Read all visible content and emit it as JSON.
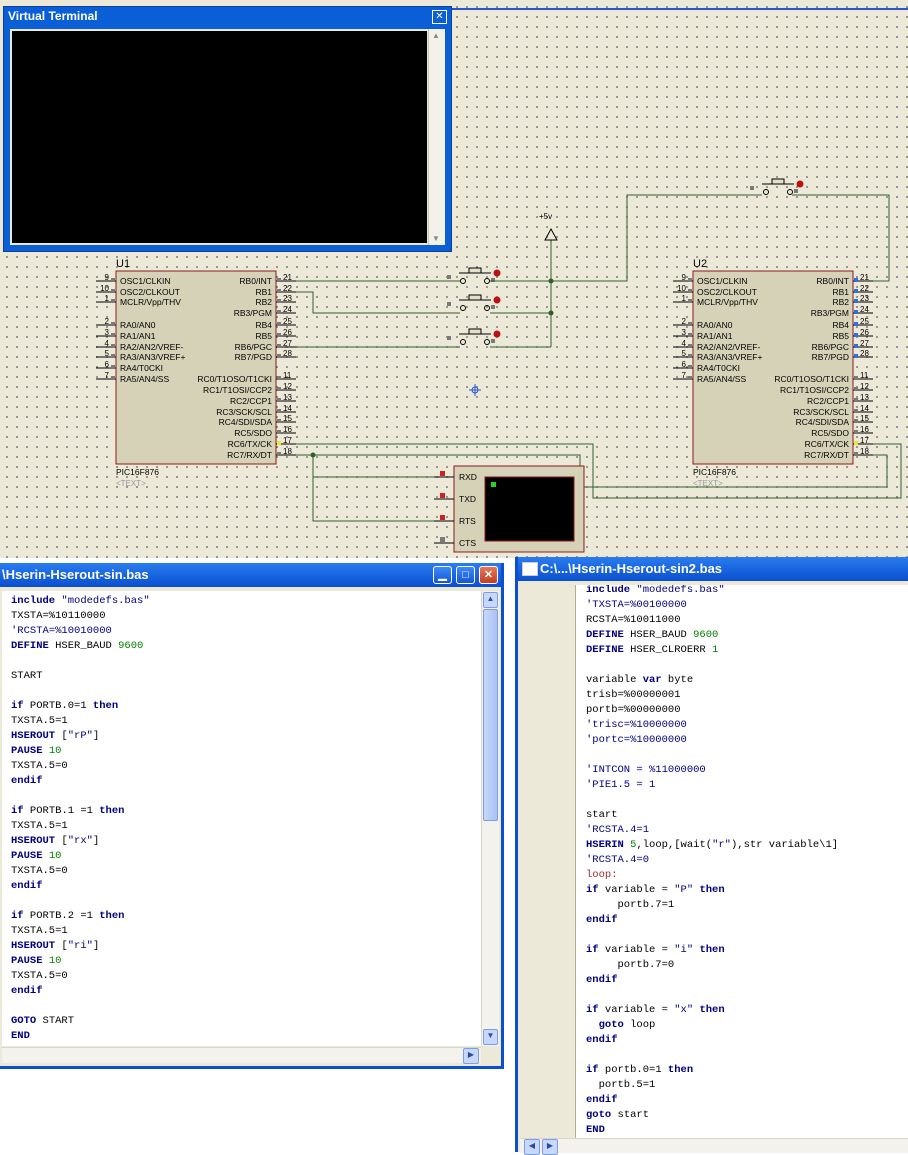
{
  "virtual_terminal": {
    "title": "Virtual Terminal",
    "close_glyph": "✕"
  },
  "schematic": {
    "power_label": "+5v",
    "u1": {
      "ref": "U1",
      "part": "PIC16F876",
      "text": "<TEXT>",
      "left_pins": [
        {
          "num": "9",
          "name": "OSC1/CLKIN"
        },
        {
          "num": "10",
          "name": "OSC2/CLKOUT"
        },
        {
          "num": "1",
          "name": "MCLR/Vpp/THV"
        },
        {
          "num": "2",
          "name": "RA0/AN0"
        },
        {
          "num": "3",
          "name": "RA1/AN1"
        },
        {
          "num": "4",
          "name": "RA2/AN2/VREF-"
        },
        {
          "num": "5",
          "name": "RA3/AN3/VREF+"
        },
        {
          "num": "6",
          "name": "RA4/T0CKI"
        },
        {
          "num": "7",
          "name": "RA5/AN4/SS"
        }
      ],
      "right_pins": [
        {
          "num": "21",
          "name": "RB0/INT"
        },
        {
          "num": "22",
          "name": "RB1"
        },
        {
          "num": "23",
          "name": "RB2"
        },
        {
          "num": "24",
          "name": "RB3/PGM"
        },
        {
          "num": "25",
          "name": "RB4"
        },
        {
          "num": "26",
          "name": "RB5"
        },
        {
          "num": "27",
          "name": "RB6/PGC"
        },
        {
          "num": "28",
          "name": "RB7/PGD"
        },
        {
          "num": "11",
          "name": "RC0/T1OSO/T1CKI"
        },
        {
          "num": "12",
          "name": "RC1/T1OSI/CCP2"
        },
        {
          "num": "13",
          "name": "RC2/CCP1"
        },
        {
          "num": "14",
          "name": "RC3/SCK/SCL"
        },
        {
          "num": "15",
          "name": "RC4/SDI/SDA"
        },
        {
          "num": "16",
          "name": "RC5/SDO"
        },
        {
          "num": "17",
          "name": "RC6/TX/CK"
        },
        {
          "num": "18",
          "name": "RC7/RX/DT"
        }
      ]
    },
    "u2": {
      "ref": "U2",
      "part": "PIC16F876",
      "text": "<TEXT>"
    },
    "terminal_pins": [
      "RXD",
      "TXD",
      "RTS",
      "CTS"
    ]
  },
  "editor1": {
    "title": "\\Hserin-Hserout-sin.bas",
    "lines": [
      [
        [
          "kw",
          "include"
        ],
        [
          "str",
          " \"modedefs.bas\""
        ]
      ],
      [
        [
          "",
          "TXSTA=%10110000"
        ]
      ],
      [
        [
          "cmt",
          "'RCSTA=%10010000"
        ]
      ],
      [
        [
          "kw",
          "DEFINE"
        ],
        [
          "",
          " HSER_BAUD "
        ],
        [
          "num",
          "9600"
        ]
      ],
      [],
      [
        [
          "",
          "START"
        ]
      ],
      [],
      [
        [
          "kw",
          "if"
        ],
        [
          "",
          " PORTB.0=1 "
        ],
        [
          "kw",
          "then"
        ]
      ],
      [
        [
          "",
          "TXSTA.5=1"
        ]
      ],
      [
        [
          "kw",
          "HSEROUT"
        ],
        [
          "",
          " ["
        ],
        [
          "str",
          "\"rP\""
        ],
        [
          "",
          "]"
        ]
      ],
      [
        [
          "kw",
          "PAUSE"
        ],
        [
          "",
          " "
        ],
        [
          "num",
          "10"
        ]
      ],
      [
        [
          "",
          "TXSTA.5=0"
        ]
      ],
      [
        [
          "kw",
          "endif"
        ]
      ],
      [],
      [
        [
          "kw",
          "if"
        ],
        [
          "",
          " PORTB.1 =1 "
        ],
        [
          "kw",
          "then"
        ]
      ],
      [
        [
          "",
          "TXSTA.5=1"
        ]
      ],
      [
        [
          "kw",
          "HSEROUT"
        ],
        [
          "",
          " ["
        ],
        [
          "str",
          "\"rx\""
        ],
        [
          "",
          "]"
        ]
      ],
      [
        [
          "kw",
          "PAUSE"
        ],
        [
          "",
          " "
        ],
        [
          "num",
          "10"
        ]
      ],
      [
        [
          "",
          "TXSTA.5=0"
        ]
      ],
      [
        [
          "kw",
          "endif"
        ]
      ],
      [],
      [
        [
          "kw",
          "if"
        ],
        [
          "",
          " PORTB.2 =1 "
        ],
        [
          "kw",
          "then"
        ]
      ],
      [
        [
          "",
          "TXSTA.5=1"
        ]
      ],
      [
        [
          "kw",
          "HSEROUT"
        ],
        [
          "",
          " ["
        ],
        [
          "str",
          "\"ri\""
        ],
        [
          "",
          "]"
        ]
      ],
      [
        [
          "kw",
          "PAUSE"
        ],
        [
          "",
          " "
        ],
        [
          "num",
          "10"
        ]
      ],
      [
        [
          "",
          "TXSTA.5=0"
        ]
      ],
      [
        [
          "kw",
          "endif"
        ]
      ],
      [],
      [
        [
          "kw",
          "GOTO"
        ],
        [
          "",
          " START"
        ]
      ],
      [
        [
          "kw",
          "END"
        ]
      ]
    ]
  },
  "editor2": {
    "title": "C:\\...\\Hserin-Hserout-sin2.bas",
    "lines": [
      [
        [
          "kw",
          "include"
        ],
        [
          "str",
          " \"modedefs.bas\""
        ]
      ],
      [
        [
          "cmt",
          "'TXSTA=%00100000"
        ]
      ],
      [
        [
          "",
          "RCSTA=%10011000"
        ]
      ],
      [
        [
          "kw",
          "DEFINE"
        ],
        [
          "",
          " HSER_BAUD "
        ],
        [
          "num",
          "9600"
        ]
      ],
      [
        [
          "kw",
          "DEFINE"
        ],
        [
          "",
          " HSER_CLROERR "
        ],
        [
          "num",
          "1"
        ]
      ],
      [],
      [
        [
          "",
          "variable "
        ],
        [
          "kw",
          "var"
        ],
        [
          "",
          " byte"
        ]
      ],
      [
        [
          "",
          "trisb=%00000001"
        ]
      ],
      [
        [
          "",
          "portb=%00000000"
        ]
      ],
      [
        [
          "cmt",
          "'trisc=%10000000"
        ]
      ],
      [
        [
          "cmt",
          "'portc=%10000000"
        ]
      ],
      [],
      [
        [
          "cmt",
          "'INTCON = %11000000"
        ]
      ],
      [
        [
          "cmt",
          "'PIE1.5 = 1"
        ]
      ],
      [],
      [
        [
          "",
          "start"
        ]
      ],
      [
        [
          "cmt",
          "'RCSTA.4=1"
        ]
      ],
      [
        [
          "kw",
          "HSERIN"
        ],
        [
          "",
          " "
        ],
        [
          "num",
          "5"
        ],
        [
          "",
          ",loop,[wait("
        ],
        [
          "str",
          "\"r\""
        ],
        [
          "",
          "),str variable\\1]"
        ]
      ],
      [
        [
          "cmt",
          "'RCSTA.4=0"
        ]
      ],
      [
        [
          "lbl",
          "loop:"
        ]
      ],
      [
        [
          "kw",
          "if"
        ],
        [
          "",
          " variable = "
        ],
        [
          "str",
          "\"P\""
        ],
        [
          "",
          " "
        ],
        [
          "kw",
          "then"
        ]
      ],
      [
        [
          "",
          "     portb.7=1"
        ]
      ],
      [
        [
          "kw",
          "endif"
        ]
      ],
      [],
      [
        [
          "kw",
          "if"
        ],
        [
          "",
          " variable = "
        ],
        [
          "str",
          "\"i\""
        ],
        [
          "",
          " "
        ],
        [
          "kw",
          "then"
        ]
      ],
      [
        [
          "",
          "     portb.7=0"
        ]
      ],
      [
        [
          "kw",
          "endif"
        ]
      ],
      [],
      [
        [
          "kw",
          "if"
        ],
        [
          "",
          " variable = "
        ],
        [
          "str",
          "\"x\""
        ],
        [
          "",
          " "
        ],
        [
          "kw",
          "then"
        ]
      ],
      [
        [
          "",
          "  "
        ],
        [
          "kw",
          "goto"
        ],
        [
          "",
          " loop"
        ]
      ],
      [
        [
          "kw",
          "endif"
        ]
      ],
      [],
      [
        [
          "kw",
          "if"
        ],
        [
          "",
          " portb.0=1 "
        ],
        [
          "kw",
          "then"
        ]
      ],
      [
        [
          "",
          "  portb.5=1"
        ]
      ],
      [
        [
          "kw",
          "endif"
        ]
      ],
      [
        [
          "kw",
          "goto"
        ],
        [
          "",
          " start"
        ]
      ],
      [
        [
          "kw",
          "END"
        ]
      ]
    ]
  },
  "colors": {
    "titlebar": "#0a5fd6",
    "keyword": "#000080",
    "number": "#008000",
    "wire": "#2f5f2f",
    "chip_fill": "#d6d2b8",
    "chip_border": "#8b1a1a"
  }
}
